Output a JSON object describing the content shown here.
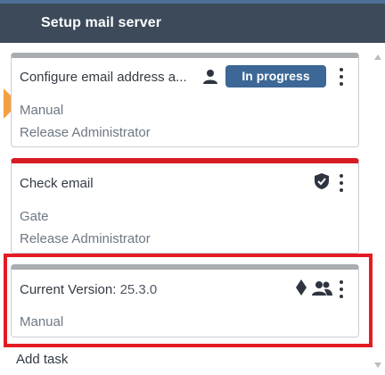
{
  "phase": {
    "title": "Setup mail server"
  },
  "tasks": [
    {
      "title": "Configure email address a...",
      "status_label": "In progress",
      "type": "Manual",
      "assignee": "Release Administrator",
      "icons": [
        "person-icon",
        "more-options-icon"
      ]
    },
    {
      "title": "Check email",
      "type": "Gate",
      "assignee": "Release Administrator",
      "icons": [
        "gate-shield-icon",
        "more-options-icon"
      ]
    },
    {
      "title": "Current Version: ",
      "version_value": "25.3.0",
      "type": "Manual",
      "icons": [
        "diamond-icon",
        "group-icon",
        "more-options-icon"
      ]
    }
  ],
  "add_task_label": "Add task",
  "colors": {
    "phase_header_bg": "#3c4a5a",
    "status_badge_bg": "#3c6796",
    "current_task_arrow": "#f5a040",
    "failed_card_accent": "#d71d24",
    "highlight_outline": "#e51b23"
  }
}
